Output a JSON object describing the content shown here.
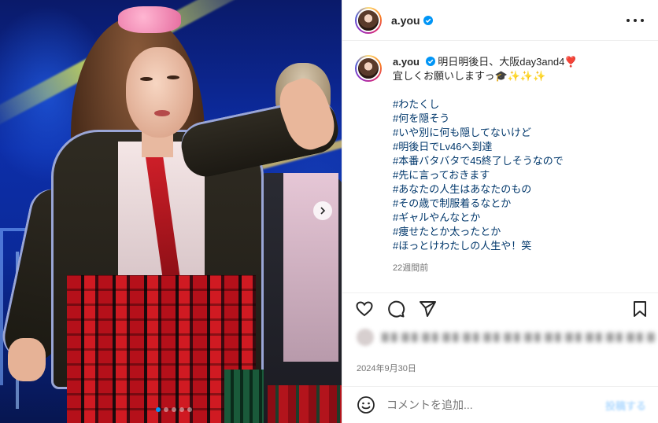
{
  "photo": {
    "alt_subject": "performer-on-stage",
    "carousel_total": 5,
    "carousel_active": 1
  },
  "header": {
    "username": "a.you",
    "verified": true
  },
  "caption": {
    "username": "a.you",
    "line1": "明日明後日、大阪day3and4❣️",
    "line2": "宜しくお願いしますっ🎓✨✨✨",
    "hashtags": [
      "#わたくし",
      "#何を隠そう",
      "#いや別に何も隠してないけど",
      "#明後日でLv46へ到達",
      "#本番バタバタで45終了しそうなので",
      "#先に言っておきます",
      "#あなたの人生はあなたのもの",
      "#その歳で制服着るなとか",
      "#ギャルやんなとか",
      "#痩せたとか太ったとか",
      "#ほっとけわたしの人生や！笑"
    ],
    "time_ago": "22週間前"
  },
  "actions": {
    "icons": [
      "heart-icon",
      "comment-icon",
      "share-icon",
      "bookmark-icon"
    ]
  },
  "post_date": "2024年9月30日",
  "comment_box": {
    "placeholder": "コメントを追加...",
    "post_label": "投稿する"
  },
  "colors": {
    "link": "#00376b",
    "verified_blue": "#0095f6",
    "muted": "#737373"
  }
}
